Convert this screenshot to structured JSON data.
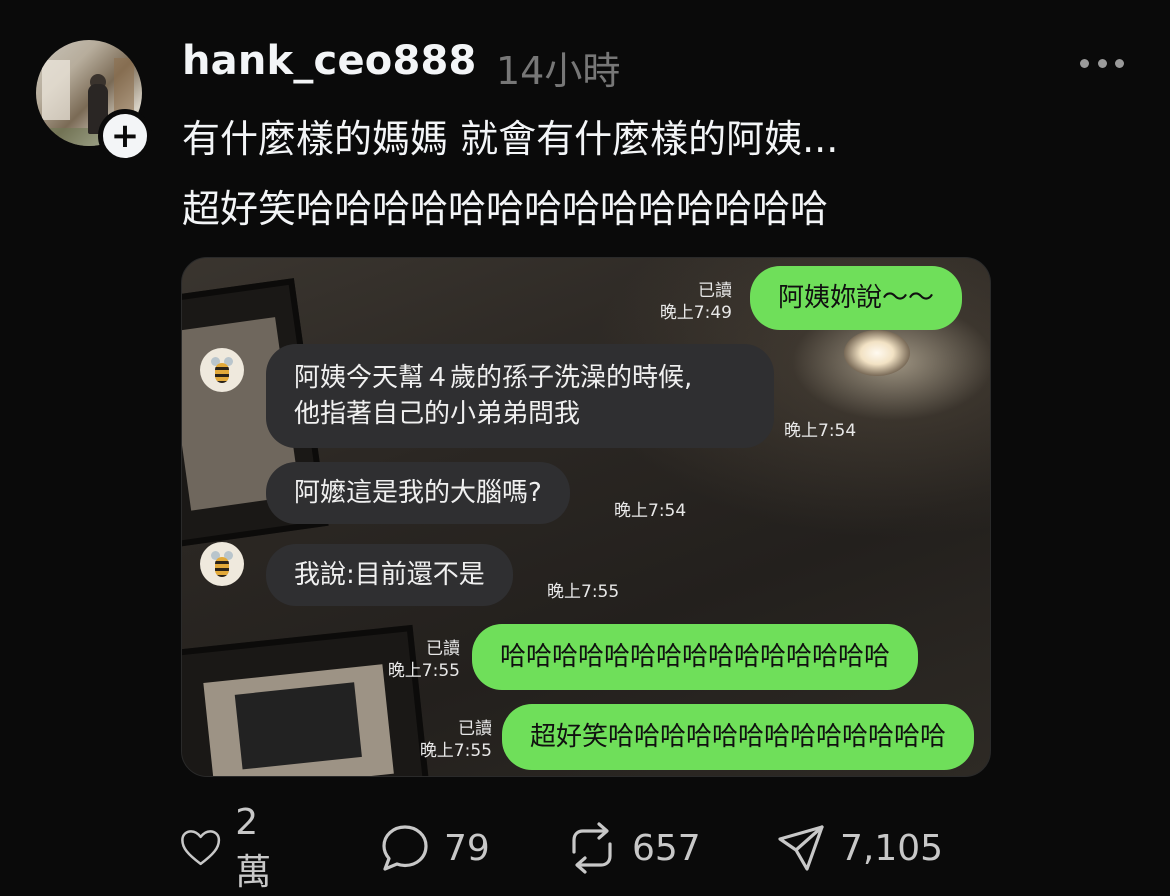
{
  "post": {
    "username": "hank_ceo888",
    "time": "14小時",
    "text_line1": "有什麼樣的媽媽 就會有什麼樣的阿姨...",
    "text_line2": "超好笑哈哈哈哈哈哈哈哈哈哈哈哈哈哈",
    "follow_symbol": "+"
  },
  "chat": {
    "messages": [
      {
        "side": "out",
        "text": "阿姨妳說～～",
        "read": "已讀",
        "time": "晚上7:49"
      },
      {
        "side": "in",
        "text_lines": [
          "阿姨今天幫４歲的孫子洗澡的時候,",
          "他指著自己的小弟弟問我"
        ],
        "time": "晚上7:54"
      },
      {
        "side": "in",
        "text": "阿嬤這是我的大腦嗎?",
        "time": "晚上7:54"
      },
      {
        "side": "in",
        "text": "我說:目前還不是",
        "time": "晚上7:55"
      },
      {
        "side": "out",
        "text": "哈哈哈哈哈哈哈哈哈哈哈哈哈哈哈",
        "read": "已讀",
        "time": "晚上7:55"
      },
      {
        "side": "out",
        "text": "超好笑哈哈哈哈哈哈哈哈哈哈哈哈哈",
        "read": "已讀",
        "time": "晚上7:55"
      }
    ]
  },
  "actions": {
    "likes": "2萬",
    "comments": "79",
    "reposts": "657",
    "shares": "7,105"
  },
  "icons": {
    "like": "heart-icon",
    "comment": "comment-bubble-icon",
    "repost": "repost-icon",
    "share": "send-icon",
    "more": "more-dots-icon",
    "chat_avatar": "bee-icon"
  },
  "colors": {
    "background": "#0a0a0a",
    "text_primary": "#f3f5f7",
    "text_secondary": "#777777",
    "bubble_out": "#6fdf5a",
    "bubble_in": "#2f2f31"
  }
}
